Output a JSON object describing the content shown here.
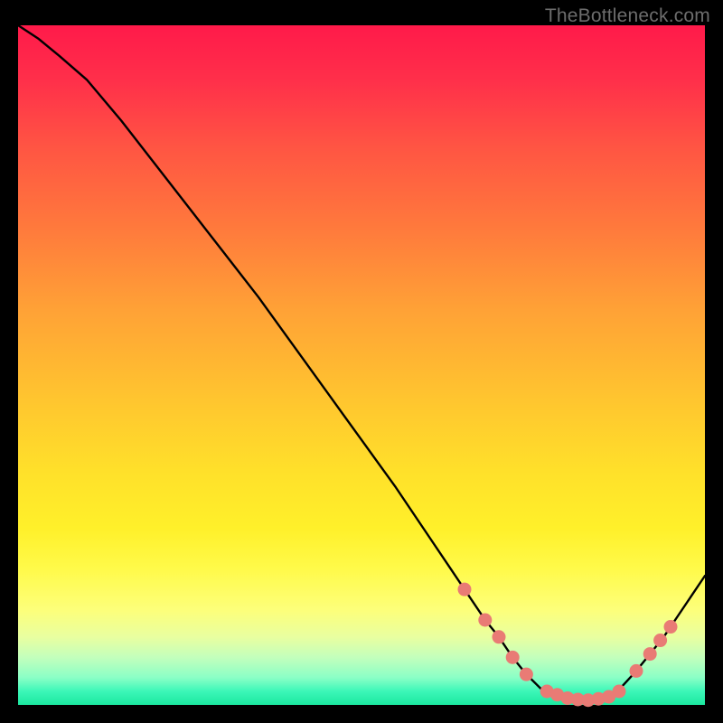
{
  "attribution": "TheBottleneck.com",
  "colors": {
    "curve_stroke": "#000000",
    "marker_fill": "#e97b75",
    "marker_stroke": "#e97b75"
  },
  "chart_data": {
    "type": "line",
    "title": "",
    "xlabel": "",
    "ylabel": "",
    "xlim": [
      0,
      100
    ],
    "ylim": [
      0,
      100
    ],
    "x": [
      0,
      3,
      6,
      10,
      15,
      20,
      25,
      30,
      35,
      40,
      45,
      50,
      55,
      60,
      63,
      65,
      68,
      70,
      72,
      74,
      76,
      78,
      80,
      82,
      84,
      86,
      88,
      90,
      92,
      94,
      96,
      98,
      100
    ],
    "values": [
      100,
      98,
      95.5,
      92,
      86,
      79.5,
      73,
      66.5,
      60,
      53,
      46,
      39,
      32,
      24.5,
      20,
      17,
      12.5,
      10,
      7,
      4.5,
      2.5,
      1.2,
      0.5,
      0.3,
      0.5,
      1.2,
      2.8,
      5,
      7.5,
      10,
      13,
      16,
      19
    ],
    "series": [
      {
        "name": "bottleneck-curve",
        "x": [
          0,
          3,
          6,
          10,
          15,
          20,
          25,
          30,
          35,
          40,
          45,
          50,
          55,
          60,
          63,
          65,
          68,
          70,
          72,
          74,
          76,
          78,
          80,
          82,
          84,
          86,
          88,
          90,
          92,
          94,
          96,
          98,
          100
        ],
        "y": [
          100,
          98,
          95.5,
          92,
          86,
          79.5,
          73,
          66.5,
          60,
          53,
          46,
          39,
          32,
          24.5,
          20,
          17,
          12.5,
          10,
          7,
          4.5,
          2.5,
          1.2,
          0.5,
          0.3,
          0.5,
          1.2,
          2.8,
          5,
          7.5,
          10,
          13,
          16,
          19
        ]
      }
    ],
    "markers": [
      {
        "x": 65,
        "y": 17
      },
      {
        "x": 68,
        "y": 12.5
      },
      {
        "x": 70,
        "y": 10
      },
      {
        "x": 72,
        "y": 7
      },
      {
        "x": 74,
        "y": 4.5
      },
      {
        "x": 77,
        "y": 2
      },
      {
        "x": 78.5,
        "y": 1.5
      },
      {
        "x": 80,
        "y": 1
      },
      {
        "x": 81.5,
        "y": 0.8
      },
      {
        "x": 83,
        "y": 0.7
      },
      {
        "x": 84.5,
        "y": 0.9
      },
      {
        "x": 86,
        "y": 1.2
      },
      {
        "x": 87.5,
        "y": 2
      },
      {
        "x": 90,
        "y": 5
      },
      {
        "x": 92,
        "y": 7.5
      },
      {
        "x": 93.5,
        "y": 9.5
      },
      {
        "x": 95,
        "y": 11.5
      }
    ]
  }
}
